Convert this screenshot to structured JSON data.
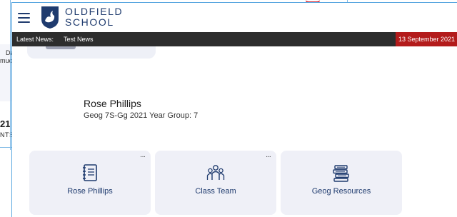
{
  "background": {
    "fragment_1": "Da",
    "fragment_2": "mue",
    "fragment_number": "21",
    "fragment_caps": "NTS"
  },
  "header": {
    "school_name_line1": "OLDFIELD",
    "school_name_line2": "SCHOOL"
  },
  "news": {
    "label": "Latest News:",
    "item": "Test News",
    "date": "13 September 2021"
  },
  "student": {
    "name": "Rose Phillips",
    "info": "Geog 7S-Gg 2021 Year Group: 7"
  },
  "tiles": [
    {
      "label": "Rose Phillips",
      "icon": "notebook-icon",
      "has_menu": true,
      "menu_label": "···"
    },
    {
      "label": "Class Team",
      "icon": "people-icon",
      "has_menu": true,
      "menu_label": "···"
    },
    {
      "label": "Geog Resources",
      "icon": "books-icon",
      "has_menu": false
    }
  ],
  "colors": {
    "brand_navy": "#1f3b6e",
    "news_bar": "#2d2d2d",
    "date_red": "#b31b1b",
    "tile_bg": "#eff0f7"
  }
}
